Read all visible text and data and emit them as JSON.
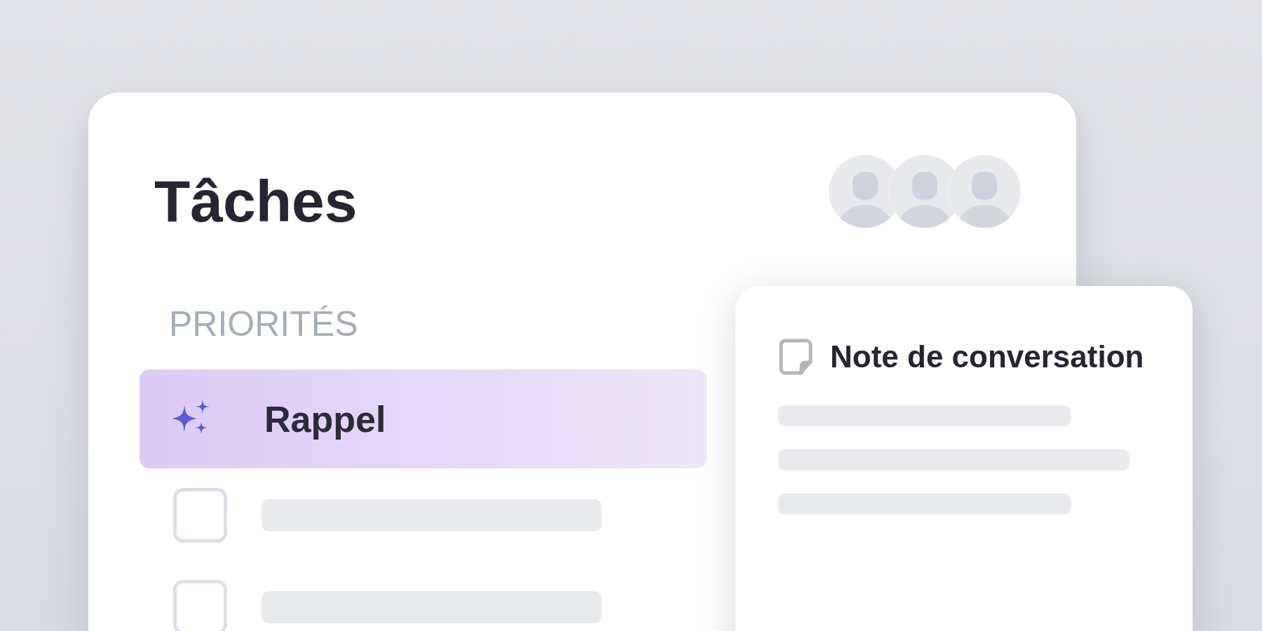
{
  "title": "Tâches",
  "section": "PRIORITÉS",
  "items": [
    {
      "kind": "highlight",
      "label": "Rappel",
      "selected": true
    },
    {
      "kind": "task",
      "selected": false,
      "checked": false
    },
    {
      "kind": "task",
      "selected": false,
      "checked": false
    }
  ],
  "note": {
    "title": "Note de conversation"
  }
}
